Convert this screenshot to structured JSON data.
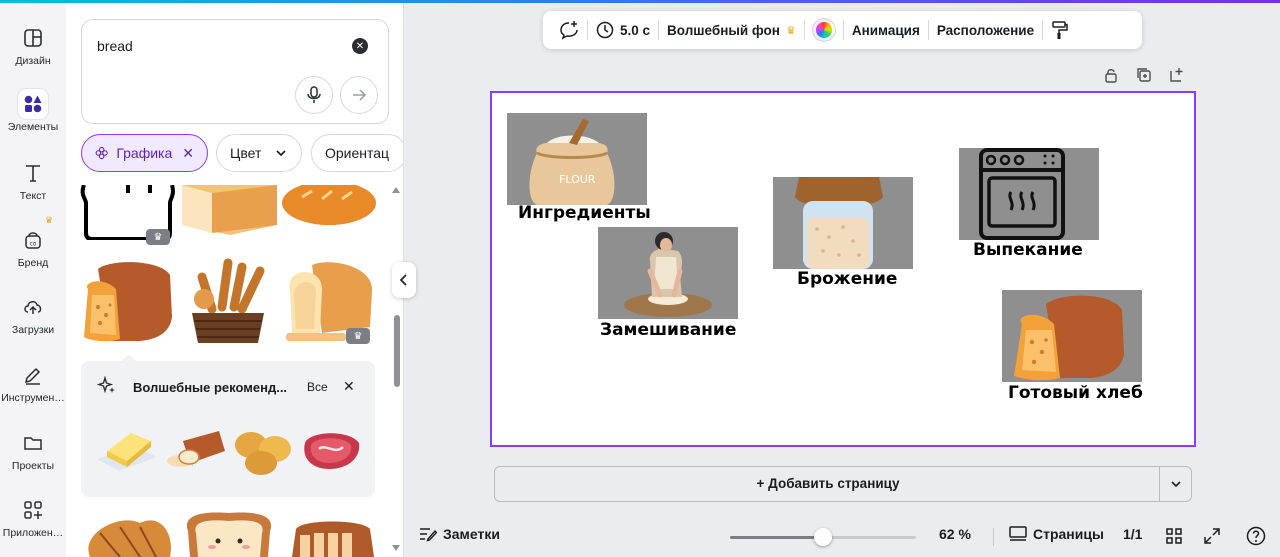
{
  "rail": {
    "items": [
      {
        "label": "Дизайн",
        "icon": "layout-icon"
      },
      {
        "label": "Элементы",
        "icon": "shapes-icon"
      },
      {
        "label": "Текст",
        "icon": "text-icon"
      },
      {
        "label": "Бренд",
        "icon": "brand-icon"
      },
      {
        "label": "Загрузки",
        "icon": "cloud-upload-icon"
      },
      {
        "label": "Инструмен…",
        "icon": "pen-tool-icon"
      },
      {
        "label": "Проекты",
        "icon": "folder-icon"
      },
      {
        "label": "Приложен…",
        "icon": "apps-icon"
      }
    ]
  },
  "search": {
    "query": "bread"
  },
  "filters": {
    "graphics": "Графика",
    "color": "Цвет",
    "orientation": "Ориентац"
  },
  "magic": {
    "title": "Волшебные рекоменд...",
    "all": "Все"
  },
  "toolbar": {
    "duration": "5.0 с",
    "magic_bg": "Волшебный фон",
    "animation": "Анимация",
    "position": "Расположение"
  },
  "page": {
    "steps": [
      {
        "label": "Ингредиенты"
      },
      {
        "label": "Замешивание"
      },
      {
        "label": "Брожение"
      },
      {
        "label": "Выпекание"
      },
      {
        "label": "Готовый хлеб"
      }
    ],
    "flour_text": "FLOUR"
  },
  "add_page": "+ Добавить страницу",
  "bottom": {
    "notes": "Заметки",
    "zoom": "62 %",
    "zoom_value": 0.5,
    "pages": "Страницы",
    "page_count": "1/1"
  },
  "colors": {
    "accent": "#8b3dff",
    "crown": "#e7a623"
  }
}
